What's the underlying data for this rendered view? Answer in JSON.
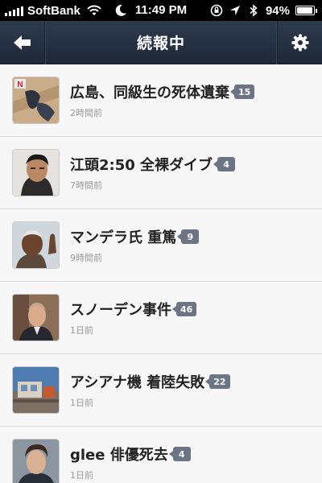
{
  "status_bar": {
    "carrier": "SoftBank",
    "time": "11:49 PM",
    "battery_percent_text": "94%",
    "battery_level": 0.94,
    "icons": [
      "signal-icon",
      "wifi-icon",
      "moon-icon",
      "rotation-lock-icon",
      "location-icon",
      "bluetooth-icon",
      "battery-icon"
    ]
  },
  "nav": {
    "title": "続報中",
    "back_icon": "back-arrow-icon",
    "settings_icon": "gear-icon"
  },
  "colors": {
    "nav_bg": "#263144",
    "badge_bg": "#6b7586",
    "list_bg": "#f7f7f7"
  },
  "items": [
    {
      "title": "広島、同級生の死体遺棄",
      "count": "15",
      "time": "2時間前",
      "thumb": "news-logo-thumbnail",
      "thumb_badge": "N"
    },
    {
      "title": "江頭2:50 全裸ダイブ",
      "count": "4",
      "time": "7時間前",
      "thumb": "portrait-thumbnail"
    },
    {
      "title": "マンデラ氏 重篤",
      "count": "9",
      "time": "9時間前",
      "thumb": "portrait-thumbnail"
    },
    {
      "title": "スノーデン事件",
      "count": "46",
      "time": "1日前",
      "thumb": "portrait-thumbnail"
    },
    {
      "title": "アシアナ機 着陸失敗",
      "count": "22",
      "time": "1日前",
      "thumb": "scene-thumbnail"
    },
    {
      "title": "glee 俳優死去",
      "count": "4",
      "time": "1日前",
      "thumb": "portrait-thumbnail"
    }
  ]
}
